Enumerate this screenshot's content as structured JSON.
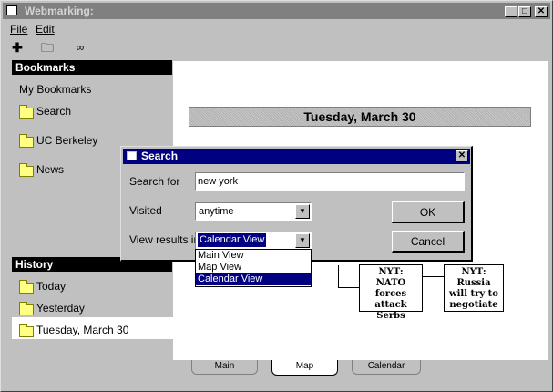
{
  "window": {
    "title": "Webmarking:"
  },
  "menu": [
    "File",
    "Edit"
  ],
  "sidebar": {
    "bookmarks_header": "Bookmarks",
    "bookmarks": [
      {
        "label": "My Bookmarks",
        "folder": false
      },
      {
        "label": "Search",
        "folder": true
      },
      {
        "label": "UC Berkeley",
        "folder": true
      },
      {
        "label": "News",
        "folder": true
      }
    ],
    "history_header": "History",
    "history": [
      {
        "label": "Today"
      },
      {
        "label": "Yesterday"
      },
      {
        "label": "Tuesday, March 30",
        "selected": true
      }
    ]
  },
  "main": {
    "date_banner": "Tuesday, March 30",
    "nodes": [
      {
        "text": "NYT: NATO forces attack Serbs"
      },
      {
        "text": "NYT: Russia will try to negotiate"
      }
    ],
    "tabs": [
      "Main",
      "Map",
      "Calendar"
    ],
    "active_tab": "Map"
  },
  "dialog": {
    "title": "Search",
    "search_label": "Search for",
    "search_value": "new york",
    "visited_label": "Visited",
    "visited_value": "anytime",
    "view_label": "View results in",
    "view_value": "Calendar View",
    "view_options": [
      "Main View",
      "Map View",
      "Calendar View"
    ],
    "ok_label": "OK",
    "cancel_label": "Cancel"
  },
  "colors": {
    "dialog_title": "#000080",
    "selection": "#000080",
    "folder": "#ffff80"
  }
}
